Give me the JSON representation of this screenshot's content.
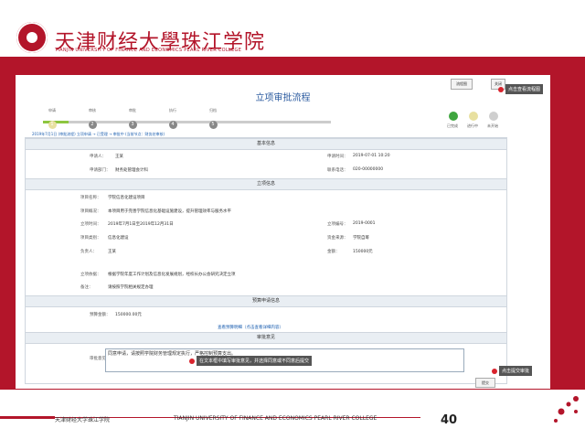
{
  "header": {
    "school_cn": "天津财经大學珠江学院",
    "school_en": "TIANJIN UNIVERSITY OF FINANCE AND ECONOMICS PEARL RIVER COLLEGE"
  },
  "screen": {
    "title": "立项审批流程",
    "top_buttons": [
      "流程图",
      "关闭"
    ],
    "steps": [
      {
        "label": "申请",
        "num": "1"
      },
      {
        "label": "审核",
        "num": "2"
      },
      {
        "label": "审批",
        "num": "3"
      },
      {
        "label": "执行",
        "num": "4"
      },
      {
        "label": "归档",
        "num": "5"
      }
    ],
    "status_line": "2019年7月1日 (审批流程) 立项申请 → 已受理 → 审批中 (当前节点：财务处审核)",
    "legend": [
      {
        "label": "已完成",
        "color": "#3fa63f"
      },
      {
        "label": "进行中",
        "color": "#e8e0a0"
      },
      {
        "label": "未开始",
        "color": "#cfcfcf"
      }
    ],
    "sections": {
      "basic": "基本信息",
      "project": "立项信息",
      "budget": "预算申请信息",
      "opinion": "审批意见"
    },
    "fields": {
      "applicant_label": "申请人：",
      "applicant_value": "王某",
      "date_label": "申请时间：",
      "date_value": "2019-07-01 10:20",
      "dept_label": "申请部门：",
      "dept_value": "财务处管理会计科",
      "phone_label": "联系电话：",
      "phone_value": "020-00000000",
      "pname_label": "项目名称：",
      "pname_value": "学院信息化建设项目",
      "pdesc_label": "项目概况：",
      "pdesc_value": "本项目用于完善学院信息化基础设施建设，提升管理效率与服务水平",
      "ptime_label": "立项时间：",
      "ptime_value": "2019年7月1日至2019年12月31日",
      "pno_label": "立项编号：",
      "pno_value": "2019-0001",
      "ptype_label": "项目类别：",
      "ptype_value": "信息化建设",
      "pfund_label": "资金来源：",
      "pfund_value": "学院自筹",
      "pmgr_label": "负责人：",
      "pmgr_value": "王某",
      "pamt_label": "金额：",
      "pamt_value": "150000元",
      "pbasis_label": "立项依据：",
      "pbasis_value": "根据学院年度工作计划及信息化发展规划，经校长办公会研究决定立项",
      "pnote_label": "备注：",
      "pnote_value": "请按照学院相关规定办理",
      "budget_label": "预算金额：",
      "budget_value": "150000.00元",
      "budget_link": "查看预算明细（点击查看详细内容）",
      "opinion_label": "审批意见：",
      "opinion_value": "同意申请，请按照学院财务管理规定执行，严格控制预算支出。"
    },
    "callouts": {
      "top_right": "点击查看流程图",
      "mid": "在文本框中填写审批意见，并选择同意或不同意后提交",
      "bottom_right": "点击提交审批"
    },
    "submit_button": "提交"
  },
  "footer": {
    "cn": "天津财经大学珠江学院",
    "en": "TIANJIN UNIVERSITY OF FINANCE AND ECONOMICS PEARL RIVER COLLEGE",
    "page": "40"
  }
}
